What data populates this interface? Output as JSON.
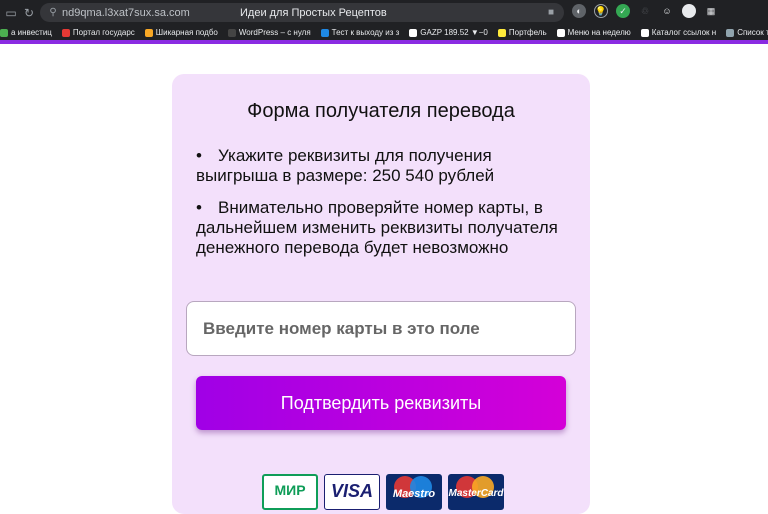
{
  "browser": {
    "url": "nd9qma.l3xat7sux.sa.com",
    "tab_title": "Идеи для Простых Рецептов",
    "bookmarks": [
      {
        "label": "а инвестиц",
        "color": "#4caf50"
      },
      {
        "label": "Портал государс",
        "color": "#e53935"
      },
      {
        "label": "Шикарная подбо",
        "color": "#f9a825"
      },
      {
        "label": "WordPress – с нуля",
        "color": "#444444"
      },
      {
        "label": "Тест к выходу из з",
        "color": "#1e88e5"
      },
      {
        "label": "GAZP 189.52 ▼−0",
        "color": "#ffffff"
      },
      {
        "label": "Портфель",
        "color": "#ffeb3b"
      },
      {
        "label": "Меню на неделю",
        "color": "#ffffff"
      },
      {
        "label": "Каталог ссылок н",
        "color": "#ffffff"
      },
      {
        "label": "Список тренинго",
        "color": "#90a4ae"
      }
    ]
  },
  "form": {
    "title": "Форма получателя перевода",
    "bullets": [
      "Укажите реквизиты для получения выигрыша в размере: 250 540 рублей",
      "Внимательно проверяйте номер карты, в дальнейшем изменить реквизиты получателя денежного перевода будет невозможно"
    ],
    "bullet_symbol": "•",
    "card_input_placeholder": "Введите номер карты в это поле",
    "submit_label": "Подтвердить реквизиты"
  },
  "payment_logos": {
    "mir": "МИР",
    "visa": "VISA",
    "maestro": "Maestro",
    "mastercard": "MasterCard"
  },
  "colors": {
    "card_bg": "#f3e0fb",
    "button_gradient_start": "#a000e6",
    "button_gradient_end": "#d400d8",
    "accent_line": "#8a2be2"
  }
}
